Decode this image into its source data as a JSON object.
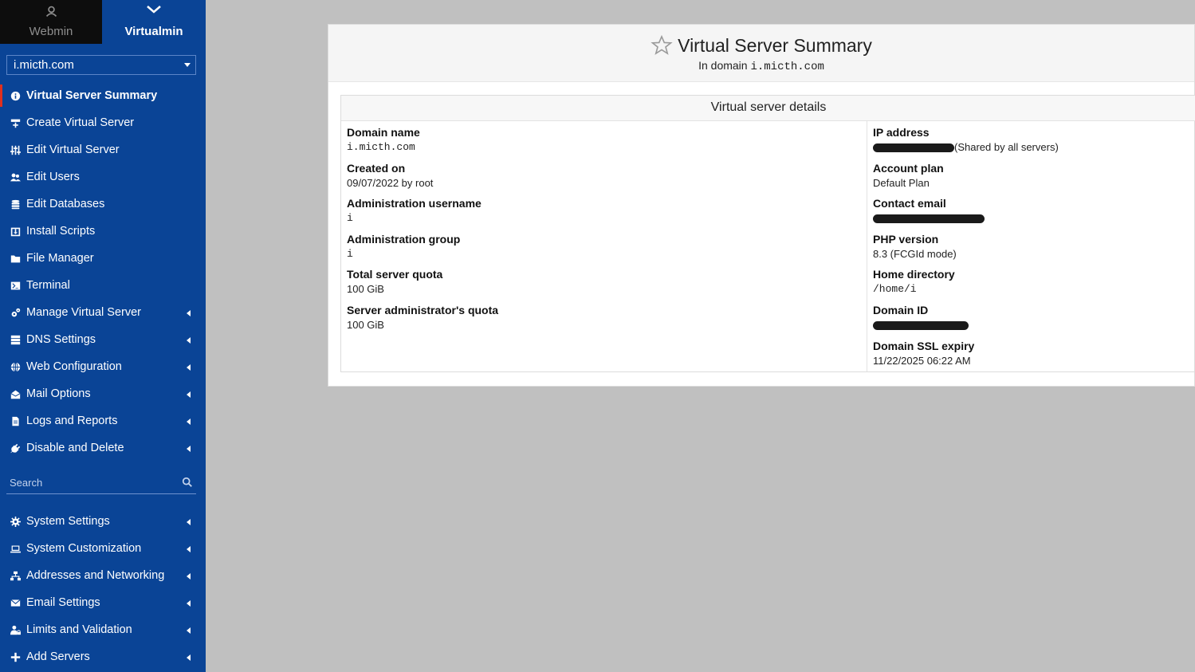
{
  "tabs": {
    "webmin": "Webmin",
    "virtualmin": "Virtualmin"
  },
  "domain_select": {
    "value": "i.micth.com"
  },
  "menu": [
    {
      "label": "Virtual Server Summary",
      "icon": "info-circle-icon",
      "active": true
    },
    {
      "label": "Create Virtual Server",
      "icon": "server-plus-icon"
    },
    {
      "label": "Edit Virtual Server",
      "icon": "sliders-icon"
    },
    {
      "label": "Edit Users",
      "icon": "users-icon"
    },
    {
      "label": "Edit Databases",
      "icon": "database-icon"
    },
    {
      "label": "Install Scripts",
      "icon": "download-box-icon"
    },
    {
      "label": "File Manager",
      "icon": "folder-icon"
    },
    {
      "label": "Terminal",
      "icon": "terminal-icon"
    },
    {
      "label": "Manage Virtual Server",
      "icon": "cogs-icon",
      "submenu": true
    },
    {
      "label": "DNS Settings",
      "icon": "server-stack-icon",
      "submenu": true
    },
    {
      "label": "Web Configuration",
      "icon": "globe-icon",
      "submenu": true
    },
    {
      "label": "Mail Options",
      "icon": "envelope-open-icon",
      "submenu": true
    },
    {
      "label": "Logs and Reports",
      "icon": "file-text-icon",
      "submenu": true
    },
    {
      "label": "Disable and Delete",
      "icon": "plug-icon",
      "submenu": true
    }
  ],
  "search": {
    "placeholder": "Search"
  },
  "menu2": [
    {
      "label": "System Settings",
      "icon": "gear-icon",
      "submenu": true
    },
    {
      "label": "System Customization",
      "icon": "laptop-icon",
      "submenu": true
    },
    {
      "label": "Addresses and Networking",
      "icon": "network-icon",
      "submenu": true
    },
    {
      "label": "Email Settings",
      "icon": "envelope-icon",
      "submenu": true
    },
    {
      "label": "Limits and Validation",
      "icon": "user-lock-icon",
      "submenu": true
    },
    {
      "label": "Add Servers",
      "icon": "plus-icon",
      "submenu": true
    }
  ],
  "page": {
    "title": "Virtual Server Summary",
    "subtitle_prefix": "In domain",
    "subtitle_domain": "i.micth.com"
  },
  "details": {
    "heading": "Virtual server details",
    "left": [
      {
        "label": "Domain name",
        "value": "i.micth.com",
        "mono": true
      },
      {
        "label": "Created on",
        "value": "09/07/2022 by root"
      },
      {
        "label": "Administration username",
        "value": "i",
        "mono": true
      },
      {
        "label": "Administration group",
        "value": "i",
        "mono": true
      },
      {
        "label": "Total server quota",
        "value": "100 GiB"
      },
      {
        "label": "Server administrator's quota",
        "value": "100 GiB"
      }
    ],
    "right": [
      {
        "label": "IP address",
        "redacted": true,
        "suffix": "(Shared by all servers)"
      },
      {
        "label": "Account plan",
        "value": "Default Plan"
      },
      {
        "label": "Contact email",
        "redacted": true
      },
      {
        "label": "PHP version",
        "value": "8.3 (FCGId mode)"
      },
      {
        "label": "Home directory",
        "value": "/home/i",
        "mono": true
      },
      {
        "label": "Domain ID",
        "redacted": true
      },
      {
        "label": "Domain SSL expiry",
        "value": "11/22/2025 06:22 AM"
      }
    ]
  }
}
